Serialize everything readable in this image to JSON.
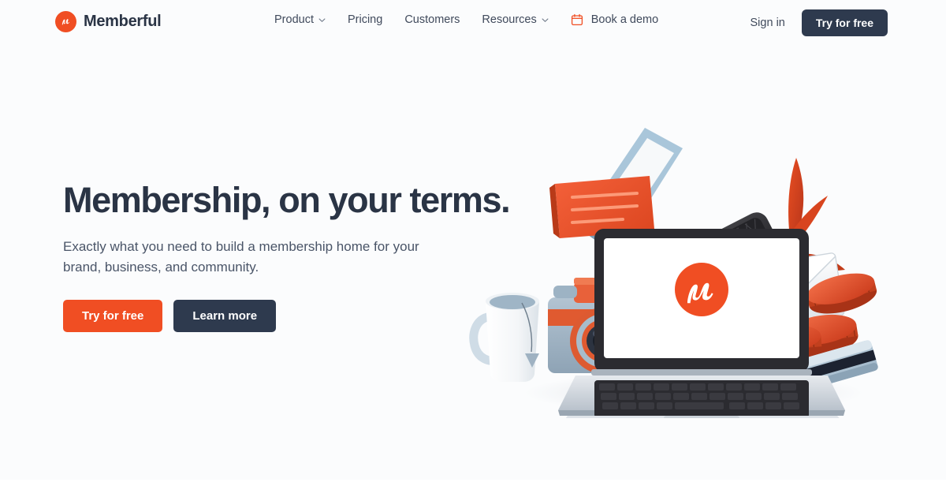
{
  "brand": {
    "name": "Memberful",
    "logo_icon": "memberful-m-logo",
    "logo_color": "#F04E23"
  },
  "header": {
    "nav": [
      {
        "label": "Product",
        "icon": "chevron-down-icon",
        "has_chevron": true
      },
      {
        "label": "Pricing",
        "icon": null,
        "has_chevron": false
      },
      {
        "label": "Customers",
        "icon": null,
        "has_chevron": false
      },
      {
        "label": "Resources",
        "icon": "chevron-down-icon",
        "has_chevron": true
      },
      {
        "label": "Book a demo",
        "icon": "calendar-icon",
        "has_chevron": false
      }
    ],
    "sign_in_label": "Sign in",
    "cta_label": "Try for free",
    "cta_bg": "#2E3A4E"
  },
  "hero": {
    "title": "Membership, on your terms.",
    "subtitle": "Exactly what you need to build a membership home for your brand, business, and community.",
    "primary_cta": "Try for free",
    "secondary_cta": "Learn more",
    "primary_cta_color": "#F04E23",
    "secondary_cta_color": "#2E3A4E",
    "background": "#FBFCFD",
    "illustration": {
      "name": "membership-tools-3d-illustration",
      "laptop_screen_logo": "memberful-m-logo",
      "objects": [
        "laptop",
        "shotgun-microphone-on-tripod",
        "tablet-frame",
        "orange-speech-bubble",
        "vintage-camera",
        "coffee-mug-with-teabag",
        "white-envelope",
        "red-leaves-in-pot",
        "stacked-coins",
        "credit-card"
      ]
    }
  }
}
